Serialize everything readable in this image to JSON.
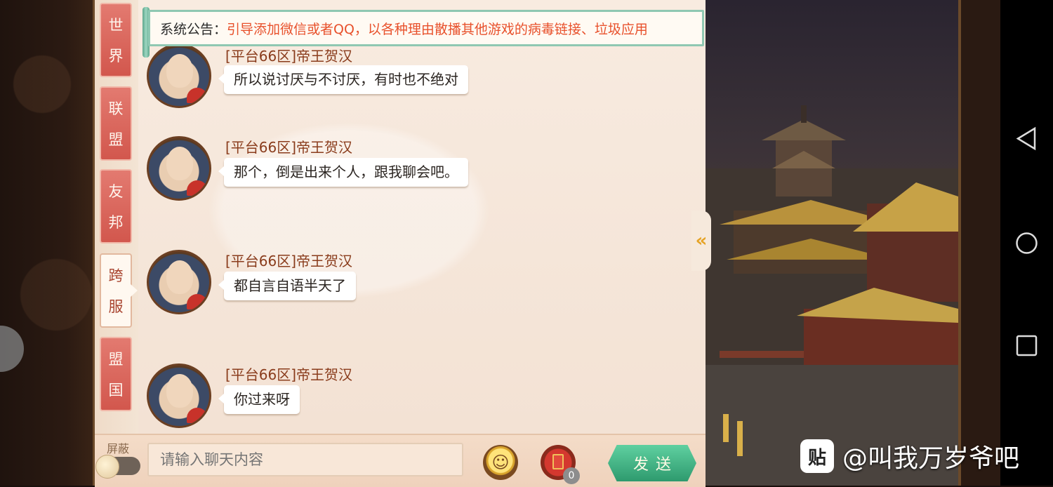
{
  "tabs": [
    {
      "label_top": "世",
      "label_bottom": "界",
      "active": false
    },
    {
      "label_top": "联",
      "label_bottom": "盟",
      "active": false
    },
    {
      "label_top": "友",
      "label_bottom": "邦",
      "active": false
    },
    {
      "label_top": "跨",
      "label_bottom": "服",
      "active": true
    },
    {
      "label_top": "盟",
      "label_bottom": "国",
      "active": false
    }
  ],
  "notice": {
    "label": "系统公告：",
    "text": "引导添加微信或者QQ，以各种理由散播其他游戏的病毒链接、垃圾应用"
  },
  "messages": [
    {
      "sender": "[平台66区]帝王贺汉",
      "text": "所以说讨厌与不讨厌，有时也不绝对"
    },
    {
      "sender": "[平台66区]帝王贺汉",
      "text": "那个，倒是出来个人，跟我聊会吧。"
    },
    {
      "sender": "[平台66区]帝王贺汉",
      "text": "都自言自语半天了"
    },
    {
      "sender": "[平台66区]帝王贺汉",
      "text": "你过来呀"
    }
  ],
  "bottom": {
    "mute_label": "屏蔽",
    "input_placeholder": "请输入聊天内容",
    "redpack_count": "0",
    "send_label": "发送"
  },
  "watermark": {
    "logo": "贴",
    "text": "@叫我万岁爷吧"
  },
  "icons": {
    "emoji": "smiley-icon",
    "redpack": "red-envelope-icon",
    "collapse": "chevron-left-icon",
    "nav_back": "triangle-back-icon",
    "nav_home": "circle-home-icon",
    "nav_recent": "square-recent-icon"
  },
  "colors": {
    "tab_red": "#d2574d",
    "sender": "#8a3c1c",
    "notice_text": "#e8512c",
    "send_green": "#2e9a6e"
  }
}
